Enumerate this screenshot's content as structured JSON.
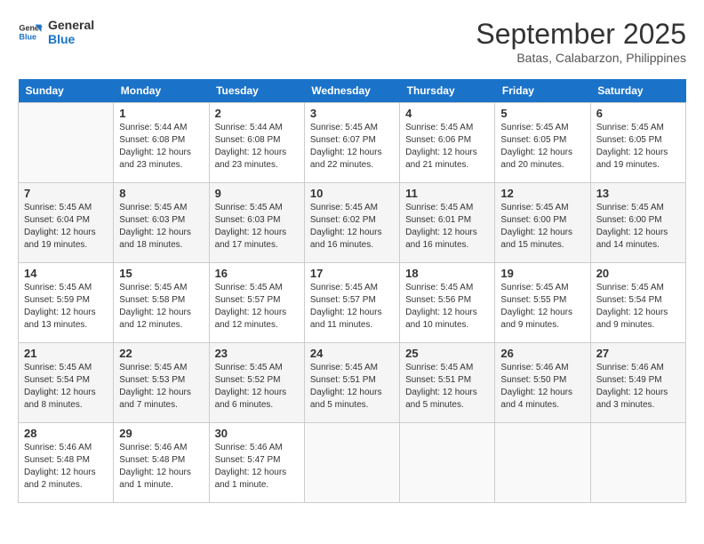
{
  "logo": {
    "line1": "General",
    "line2": "Blue"
  },
  "title": "September 2025",
  "subtitle": "Batas, Calabarzon, Philippines",
  "days_of_week": [
    "Sunday",
    "Monday",
    "Tuesday",
    "Wednesday",
    "Thursday",
    "Friday",
    "Saturday"
  ],
  "weeks": [
    [
      {
        "day": "",
        "info": ""
      },
      {
        "day": "1",
        "info": "Sunrise: 5:44 AM\nSunset: 6:08 PM\nDaylight: 12 hours\nand 23 minutes."
      },
      {
        "day": "2",
        "info": "Sunrise: 5:44 AM\nSunset: 6:08 PM\nDaylight: 12 hours\nand 23 minutes."
      },
      {
        "day": "3",
        "info": "Sunrise: 5:45 AM\nSunset: 6:07 PM\nDaylight: 12 hours\nand 22 minutes."
      },
      {
        "day": "4",
        "info": "Sunrise: 5:45 AM\nSunset: 6:06 PM\nDaylight: 12 hours\nand 21 minutes."
      },
      {
        "day": "5",
        "info": "Sunrise: 5:45 AM\nSunset: 6:05 PM\nDaylight: 12 hours\nand 20 minutes."
      },
      {
        "day": "6",
        "info": "Sunrise: 5:45 AM\nSunset: 6:05 PM\nDaylight: 12 hours\nand 19 minutes."
      }
    ],
    [
      {
        "day": "7",
        "info": "Sunrise: 5:45 AM\nSunset: 6:04 PM\nDaylight: 12 hours\nand 19 minutes."
      },
      {
        "day": "8",
        "info": "Sunrise: 5:45 AM\nSunset: 6:03 PM\nDaylight: 12 hours\nand 18 minutes."
      },
      {
        "day": "9",
        "info": "Sunrise: 5:45 AM\nSunset: 6:03 PM\nDaylight: 12 hours\nand 17 minutes."
      },
      {
        "day": "10",
        "info": "Sunrise: 5:45 AM\nSunset: 6:02 PM\nDaylight: 12 hours\nand 16 minutes."
      },
      {
        "day": "11",
        "info": "Sunrise: 5:45 AM\nSunset: 6:01 PM\nDaylight: 12 hours\nand 16 minutes."
      },
      {
        "day": "12",
        "info": "Sunrise: 5:45 AM\nSunset: 6:00 PM\nDaylight: 12 hours\nand 15 minutes."
      },
      {
        "day": "13",
        "info": "Sunrise: 5:45 AM\nSunset: 6:00 PM\nDaylight: 12 hours\nand 14 minutes."
      }
    ],
    [
      {
        "day": "14",
        "info": "Sunrise: 5:45 AM\nSunset: 5:59 PM\nDaylight: 12 hours\nand 13 minutes."
      },
      {
        "day": "15",
        "info": "Sunrise: 5:45 AM\nSunset: 5:58 PM\nDaylight: 12 hours\nand 12 minutes."
      },
      {
        "day": "16",
        "info": "Sunrise: 5:45 AM\nSunset: 5:57 PM\nDaylight: 12 hours\nand 12 minutes."
      },
      {
        "day": "17",
        "info": "Sunrise: 5:45 AM\nSunset: 5:57 PM\nDaylight: 12 hours\nand 11 minutes."
      },
      {
        "day": "18",
        "info": "Sunrise: 5:45 AM\nSunset: 5:56 PM\nDaylight: 12 hours\nand 10 minutes."
      },
      {
        "day": "19",
        "info": "Sunrise: 5:45 AM\nSunset: 5:55 PM\nDaylight: 12 hours\nand 9 minutes."
      },
      {
        "day": "20",
        "info": "Sunrise: 5:45 AM\nSunset: 5:54 PM\nDaylight: 12 hours\nand 9 minutes."
      }
    ],
    [
      {
        "day": "21",
        "info": "Sunrise: 5:45 AM\nSunset: 5:54 PM\nDaylight: 12 hours\nand 8 minutes."
      },
      {
        "day": "22",
        "info": "Sunrise: 5:45 AM\nSunset: 5:53 PM\nDaylight: 12 hours\nand 7 minutes."
      },
      {
        "day": "23",
        "info": "Sunrise: 5:45 AM\nSunset: 5:52 PM\nDaylight: 12 hours\nand 6 minutes."
      },
      {
        "day": "24",
        "info": "Sunrise: 5:45 AM\nSunset: 5:51 PM\nDaylight: 12 hours\nand 5 minutes."
      },
      {
        "day": "25",
        "info": "Sunrise: 5:45 AM\nSunset: 5:51 PM\nDaylight: 12 hours\nand 5 minutes."
      },
      {
        "day": "26",
        "info": "Sunrise: 5:46 AM\nSunset: 5:50 PM\nDaylight: 12 hours\nand 4 minutes."
      },
      {
        "day": "27",
        "info": "Sunrise: 5:46 AM\nSunset: 5:49 PM\nDaylight: 12 hours\nand 3 minutes."
      }
    ],
    [
      {
        "day": "28",
        "info": "Sunrise: 5:46 AM\nSunset: 5:48 PM\nDaylight: 12 hours\nand 2 minutes."
      },
      {
        "day": "29",
        "info": "Sunrise: 5:46 AM\nSunset: 5:48 PM\nDaylight: 12 hours\nand 1 minute."
      },
      {
        "day": "30",
        "info": "Sunrise: 5:46 AM\nSunset: 5:47 PM\nDaylight: 12 hours\nand 1 minute."
      },
      {
        "day": "",
        "info": ""
      },
      {
        "day": "",
        "info": ""
      },
      {
        "day": "",
        "info": ""
      },
      {
        "day": "",
        "info": ""
      }
    ]
  ]
}
